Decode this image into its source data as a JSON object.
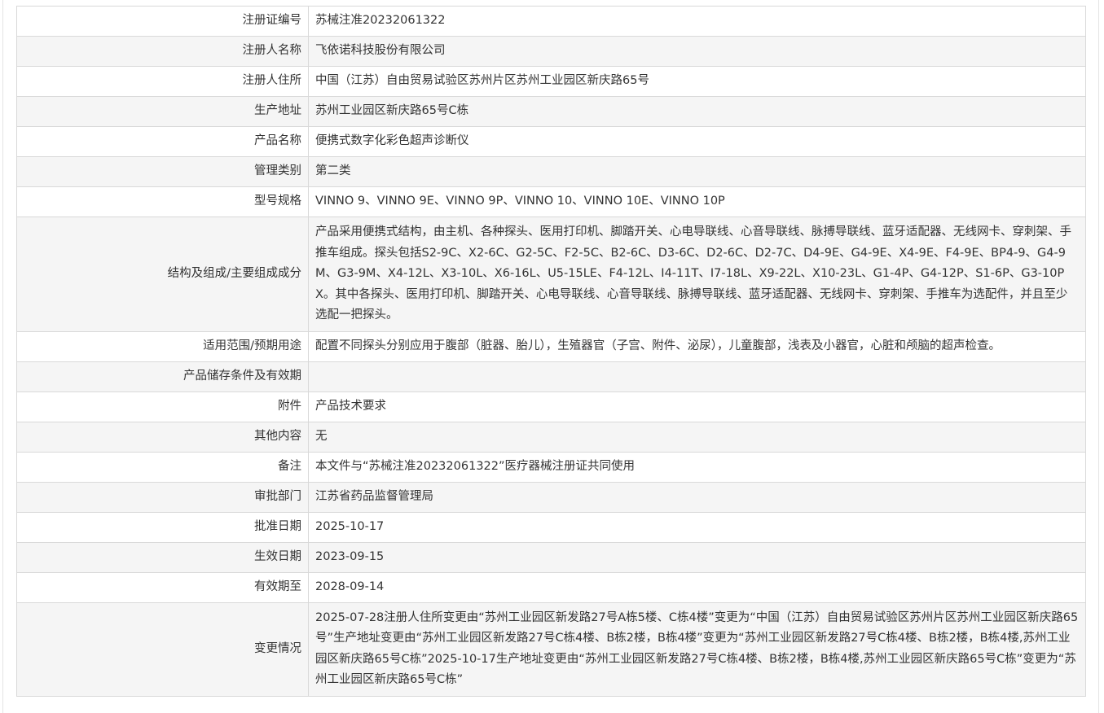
{
  "rows": [
    {
      "label": "注册证编号",
      "value": "苏械注准20232061322"
    },
    {
      "label": "注册人名称",
      "value": "飞依诺科技股份有限公司"
    },
    {
      "label": "注册人住所",
      "value": "中国（江苏）自由贸易试验区苏州片区苏州工业园区新庆路65号"
    },
    {
      "label": "生产地址",
      "value": "苏州工业园区新庆路65号C栋"
    },
    {
      "label": "产品名称",
      "value": "便携式数字化彩色超声诊断仪"
    },
    {
      "label": "管理类别",
      "value": "第二类"
    },
    {
      "label": "型号规格",
      "value": "VINNO 9、VINNO 9E、VINNO 9P、VINNO 10、VINNO 10E、VINNO 10P"
    },
    {
      "label": "结构及组成/主要组成成分",
      "value": "产品采用便携式结构，由主机、各种探头、医用打印机、脚踏开关、心电导联线、心音导联线、脉搏导联线、蓝牙适配器、无线网卡、穿刺架、手推车组成。探头包括S2-9C、X2-6C、G2-5C、F2-5C、B2-6C、D3-6C、D2-6C、D2-7C、D4-9E、G4-9E、X4-9E、F4-9E、BP4-9、G4-9M、G3-9M、X4-12L、X3-10L、X6-16L、U5-15LE、F4-12L、I4-11T、I7-18L、X9-22L、X10-23L、G1-4P、G4-12P、S1-6P、G3-10PX。其中各探头、医用打印机、脚踏开关、心电导联线、心音导联线、脉搏导联线、蓝牙适配器、无线网卡、穿刺架、手推车为选配件，并且至少选配一把探头。"
    },
    {
      "label": "适用范围/预期用途",
      "value": "配置不同探头分别应用于腹部（脏器、胎儿），生殖器官（子宫、附件、泌尿），儿童腹部，浅表及小器官，心脏和颅脑的超声检查。"
    },
    {
      "label": "产品储存条件及有效期",
      "value": ""
    },
    {
      "label": "附件",
      "value": "产品技术要求"
    },
    {
      "label": "其他内容",
      "value": "无"
    },
    {
      "label": "备注",
      "value": "本文件与“苏械注准20232061322”医疗器械注册证共同使用"
    },
    {
      "label": "审批部门",
      "value": "江苏省药品监督管理局"
    },
    {
      "label": "批准日期",
      "value": "2025-10-17"
    },
    {
      "label": "生效日期",
      "value": "2023-09-15"
    },
    {
      "label": "有效期至",
      "value": "2028-09-14"
    },
    {
      "label": "变更情况",
      "value": "2025-07-28注册人住所变更由“苏州工业园区新发路27号A栋5楼、C栋4楼”变更为“中国（江苏）自由贸易试验区苏州片区苏州工业园区新庆路65号”生产地址变更由“苏州工业园区新发路27号C栋4楼、B栋2楼，B栋4楼”变更为“苏州工业园区新发路27号C栋4楼、B栋2楼，B栋4楼,苏州工业园区新庆路65号C栋”2025-10-17生产地址变更由“苏州工业园区新发路27号C栋4楼、B栋2楼，B栋4楼,苏州工业园区新庆路65号C栋”变更为“苏州工业园区新庆路65号C栋”"
    }
  ]
}
